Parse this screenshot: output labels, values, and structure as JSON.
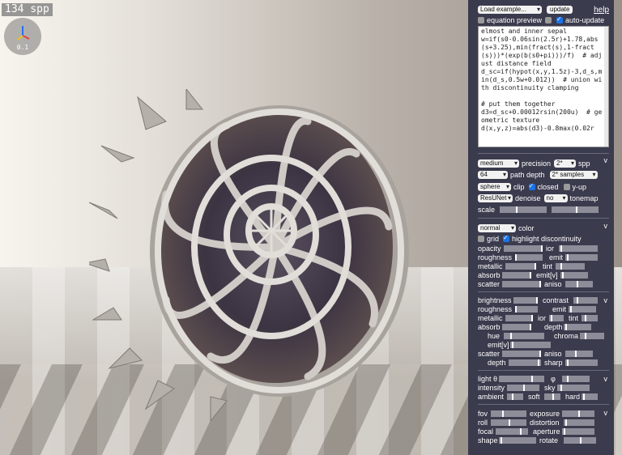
{
  "viewport": {
    "spp_label": "134 spp",
    "gizmo_scale": "0.1"
  },
  "top": {
    "load_example": "Load example...",
    "update": "update",
    "help": "help",
    "equation_preview": "equation preview",
    "auto_update": "auto-update"
  },
  "code": {
    "text": "elmost and inner sepal\nw=if(s0-0.06sin(2.5r)+1.78,abs(s+3.25),min(fract(s),1-fract(s)))*(exp(b(s0+pi)))/f)  # adjust distance field\nd_sc=if(hypot(x,y,1.5z)-3,d_s,min(d_s,0.5w+0.012))  # union with discontinuity clamping\n\n# put them together\nd3=d_sc+0.00012rsin(200u)  # geometric texture\nd(x,y,z)=abs(d3)-0.8max(0.02r"
  },
  "render": {
    "quality": "medium",
    "precision_label": "precision",
    "spp_value": "2*",
    "spp_label": "spp",
    "depth_value": "64",
    "depth_label": "path depth",
    "samples_value": "2* samples",
    "clip_value": "sphere",
    "clip_label": "clip",
    "closed_label": "closed",
    "yup_label": "y-up",
    "denoise_value": "ResUNet",
    "denoise_label": "denoise",
    "tonemap_value": "no",
    "tonemap_label": "tonemap",
    "scale_label": "scale"
  },
  "material": {
    "mode": "normal",
    "color_label": "color",
    "grid_label": "grid",
    "highlight_label": "highlight discontinuity",
    "opacity": "opacity",
    "ior": "ior",
    "roughness": "roughness",
    "emit": "emit",
    "metallic": "metallic",
    "tint": "tint",
    "absorb": "absorb",
    "emitv": "emit[v]",
    "scatter": "scatter",
    "aniso": "aniso"
  },
  "material2": {
    "brightness": "brightness",
    "contrast": "contrast",
    "roughness": "roughness",
    "emit": "emit",
    "metallic": "metallic",
    "ior": "ior",
    "tint": "tint",
    "absorb": "absorb",
    "depth": "depth",
    "hue": "hue",
    "chroma": "chroma",
    "emitv": "emit[v]",
    "scatter": "scatter",
    "aniso": "aniso",
    "depth2": "depth",
    "sharp": "sharp"
  },
  "light": {
    "theta": "light θ",
    "phi": "φ",
    "intensity": "intensity",
    "sky": "sky",
    "ambient": "ambient",
    "soft": "soft",
    "hard": "hard"
  },
  "camera": {
    "fov": "fov",
    "exposure": "exposure",
    "roll": "roll",
    "distortion": "distortion",
    "focal": "focal",
    "aperture": "aperture",
    "shape": "shape",
    "rotate": "rotate"
  },
  "chevrons": {
    "v": "v"
  },
  "colors": {
    "panel_bg": "#3b3b4e",
    "accent": "#1a73e8"
  }
}
